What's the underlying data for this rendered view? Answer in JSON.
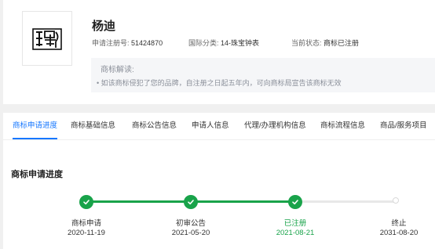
{
  "trademark": {
    "name": "杨迪",
    "reg_no_label": "申请注册号:",
    "reg_no": "51424870",
    "class_label": "国际分类:",
    "class_value": "14-珠宝钟表",
    "status_label": "当前状态:",
    "status_value": "商标已注册"
  },
  "interpretation": {
    "title": "商标解读:",
    "text": "• 如该商标侵犯了您的品牌，自注册之日起五年内，可向商标局宣告该商标无效"
  },
  "tabs": [
    {
      "label": "商标申请进度",
      "active": true
    },
    {
      "label": "商标基础信息"
    },
    {
      "label": "商标公告信息"
    },
    {
      "label": "申请人信息"
    },
    {
      "label": "代理/办理机构信息"
    },
    {
      "label": "商标流程信息"
    },
    {
      "label": "商品/服务项目"
    }
  ],
  "progress": {
    "title": "商标申请进度",
    "steps": [
      {
        "label": "商标申请",
        "date": "2020-11-19",
        "state": "done"
      },
      {
        "label": "初审公告",
        "date": "2021-05-20",
        "state": "done"
      },
      {
        "label": "已注册",
        "date": "2021-08-21",
        "state": "current"
      },
      {
        "label": "终止",
        "date": "2031-08-20",
        "state": "pending"
      }
    ]
  },
  "colors": {
    "accent": "#1677ff",
    "success": "#19a34a",
    "pending": "#d9d9d9"
  },
  "icons": {
    "logo": "trademark-seal-logo",
    "step_done": "check-icon"
  }
}
